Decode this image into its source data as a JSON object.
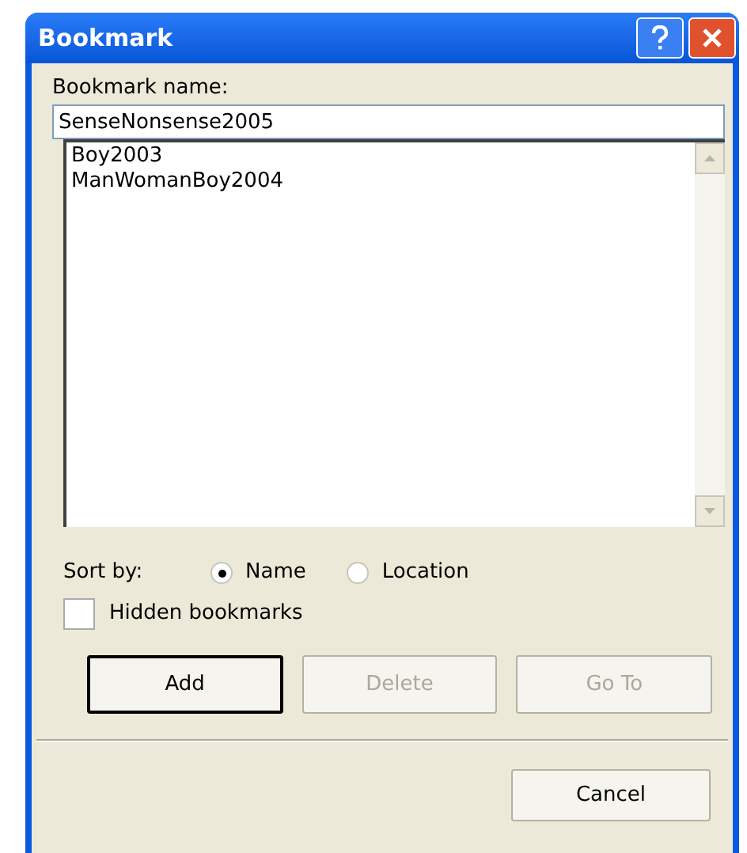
{
  "window": {
    "title": "Bookmark"
  },
  "name_label": "Bookmark name:",
  "name_field": {
    "value": "SenseNonsense2005"
  },
  "bookmarks": [
    {
      "label": "Boy2003",
      "selected": false
    },
    {
      "label": "ManWomanBoy2004",
      "selected": false
    }
  ],
  "sort_label": "Sort by:",
  "sort_options": [
    {
      "label": "Name",
      "selected": true
    },
    {
      "label": "Location",
      "selected": false
    }
  ],
  "hidden_bookmarks": {
    "label": "Hidden bookmarks",
    "checked": false
  },
  "buttons": [
    {
      "label": "Add",
      "disabled": false,
      "default": true
    },
    {
      "label": "Delete",
      "disabled": true,
      "default": false
    },
    {
      "label": "Go To",
      "disabled": true,
      "default": false
    }
  ],
  "cancel_button": {
    "label": "Cancel"
  }
}
